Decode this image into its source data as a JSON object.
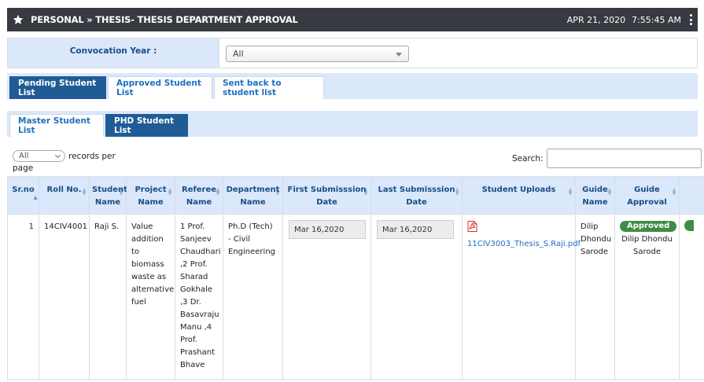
{
  "header": {
    "breadcrumb": "PERSONAL » THESIS- THESIS DEPARTMENT APPROVAL",
    "date": "APR 21, 2020",
    "time": "7:55:45 AM"
  },
  "filter": {
    "label": "Convocation Year :",
    "selected": "All"
  },
  "tabs_primary": [
    {
      "label": "Pending Student List"
    },
    {
      "label": "Approved Student List"
    },
    {
      "label": "Sent back to student list"
    }
  ],
  "tabs_secondary": [
    {
      "label": "Master Student List"
    },
    {
      "label": "PHD Student List"
    }
  ],
  "table_controls": {
    "records_select": "All",
    "records_label": "records per",
    "records_label_2": "page",
    "search_label": "Search:",
    "search_value": ""
  },
  "table": {
    "columns": [
      "Sr.no",
      "Roll No.",
      "Student Name",
      "Project Name",
      "Referee Name",
      "Department Name",
      "First Submisssion Date",
      "Last Submisssion Date",
      "Student Uploads",
      "Guide Name",
      "Guide Approval",
      ""
    ],
    "row": {
      "srno": "1",
      "roll": "14CIV4001",
      "student": "Raji S.",
      "project": "Value addition to biomass waste as alternative fuel",
      "referee": "1 Prof. Sanjeev Chaudhari ,2 Prof. Sharad Gokhale ,3 Dr. Basavraju Manu ,4 Prof. Prashant Bhave",
      "department": "Ph.D (Tech) - Civil Engineering",
      "first_date": "Mar 16,2020",
      "last_date": "Mar 16,2020",
      "upload": "11CIV3003_Thesis_S.Raji.pdf",
      "guide": "Dilip Dhondu Sarode",
      "approval_badge": "Approved",
      "approval_by": "Dilip Dhondu Sarode"
    }
  },
  "colors": {
    "header_bg": "#373a40",
    "accent": "#1f5c96",
    "tab_bar": "#dbe8fb",
    "approved": "#3e8c46"
  }
}
